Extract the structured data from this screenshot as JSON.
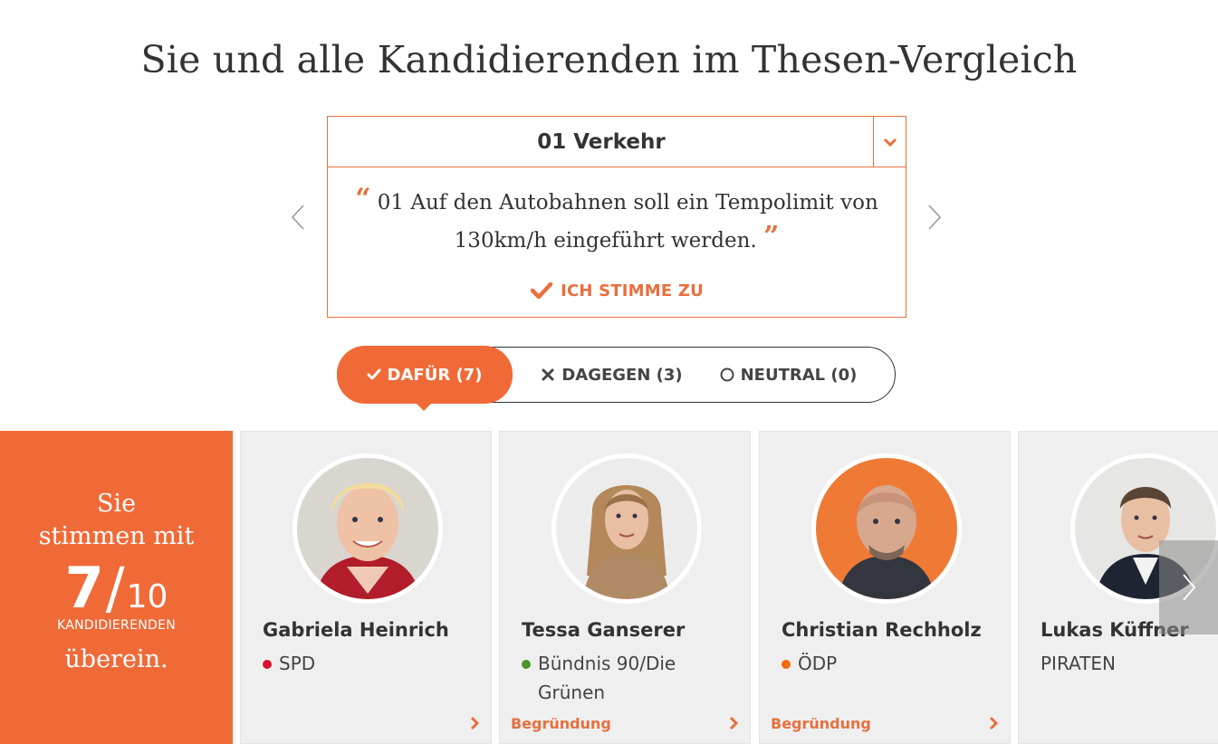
{
  "page": {
    "title": "Sie und alle Kandidierenden im Thesen-Vergleich"
  },
  "thesis": {
    "topic": "01 Verkehr",
    "text": "01 Auf den Autobahnen soll ein Tempolimit von 130km/h eingeführt werden.",
    "open_quote": "“",
    "close_quote": "”",
    "user_answer": "ICH STIMME ZU"
  },
  "filters": [
    {
      "label": "DAFÜR (7)",
      "active": true
    },
    {
      "label": "DAGEGEN (3)",
      "active": false
    },
    {
      "label": "NEUTRAL (0)",
      "active": false
    }
  ],
  "summary": {
    "line1": "Sie",
    "line2": "stimmen mit",
    "count": "7",
    "slash": "/",
    "total": "10",
    "unit": "KANDIDIERENDEN",
    "line3": "überein."
  },
  "candidates": [
    {
      "name": "Gabriela Heinrich",
      "party": "SPD",
      "party_color": "#d7132e",
      "reason_label": ""
    },
    {
      "name": "Tessa Ganserer",
      "party": "Bündnis 90/Die Grünen",
      "party_line1": "Bündnis 90/Die",
      "party_line2": "Grünen",
      "party_color": "#46962b",
      "reason_label": "Begründung"
    },
    {
      "name": "Christian Rechholz",
      "party": "ÖDP",
      "party_color": "#f06a10",
      "reason_label": "Begründung"
    },
    {
      "name": "Lukas Küffner",
      "party": "PIRATEN",
      "party_color": "",
      "reason_label": ""
    }
  ],
  "colors": {
    "accent": "#f06a38",
    "border": "#e86f3e",
    "card_bg": "#efefef"
  }
}
